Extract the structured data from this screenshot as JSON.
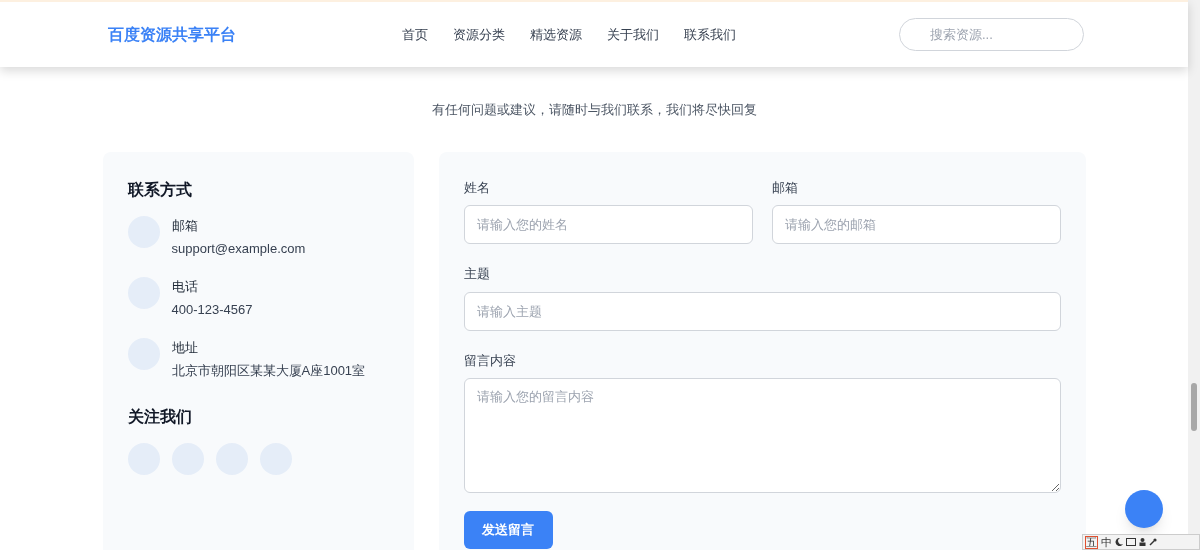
{
  "header": {
    "logo": "百度资源共享平台",
    "nav": [
      {
        "label": "首页"
      },
      {
        "label": "资源分类"
      },
      {
        "label": "精选资源"
      },
      {
        "label": "关于我们"
      },
      {
        "label": "联系我们"
      }
    ],
    "search": {
      "placeholder": "搜索资源..."
    }
  },
  "page": {
    "subtitle": "有任何问题或建议，请随时与我们联系，我们将尽快回复"
  },
  "contact_card": {
    "title": "联系方式",
    "items": [
      {
        "label": "邮箱",
        "value": "support@example.com"
      },
      {
        "label": "电话",
        "value": "400-123-4567"
      },
      {
        "label": "地址",
        "value": "北京市朝阳区某某大厦A座1001室"
      }
    ],
    "follow_title": "关注我们"
  },
  "form": {
    "fields": [
      {
        "kind": "input",
        "label": "姓名",
        "placeholder": "请输入您的姓名"
      },
      {
        "kind": "input",
        "label": "邮箱",
        "placeholder": "请输入您的邮箱"
      },
      {
        "kind": "input",
        "label": "主题",
        "placeholder": "请输入主题"
      },
      {
        "kind": "textarea",
        "label": "留言内容",
        "placeholder": "请输入您的留言内容"
      }
    ],
    "submit": "发送留言"
  },
  "ime_bar": {
    "items": [
      "五",
      "中"
    ]
  }
}
